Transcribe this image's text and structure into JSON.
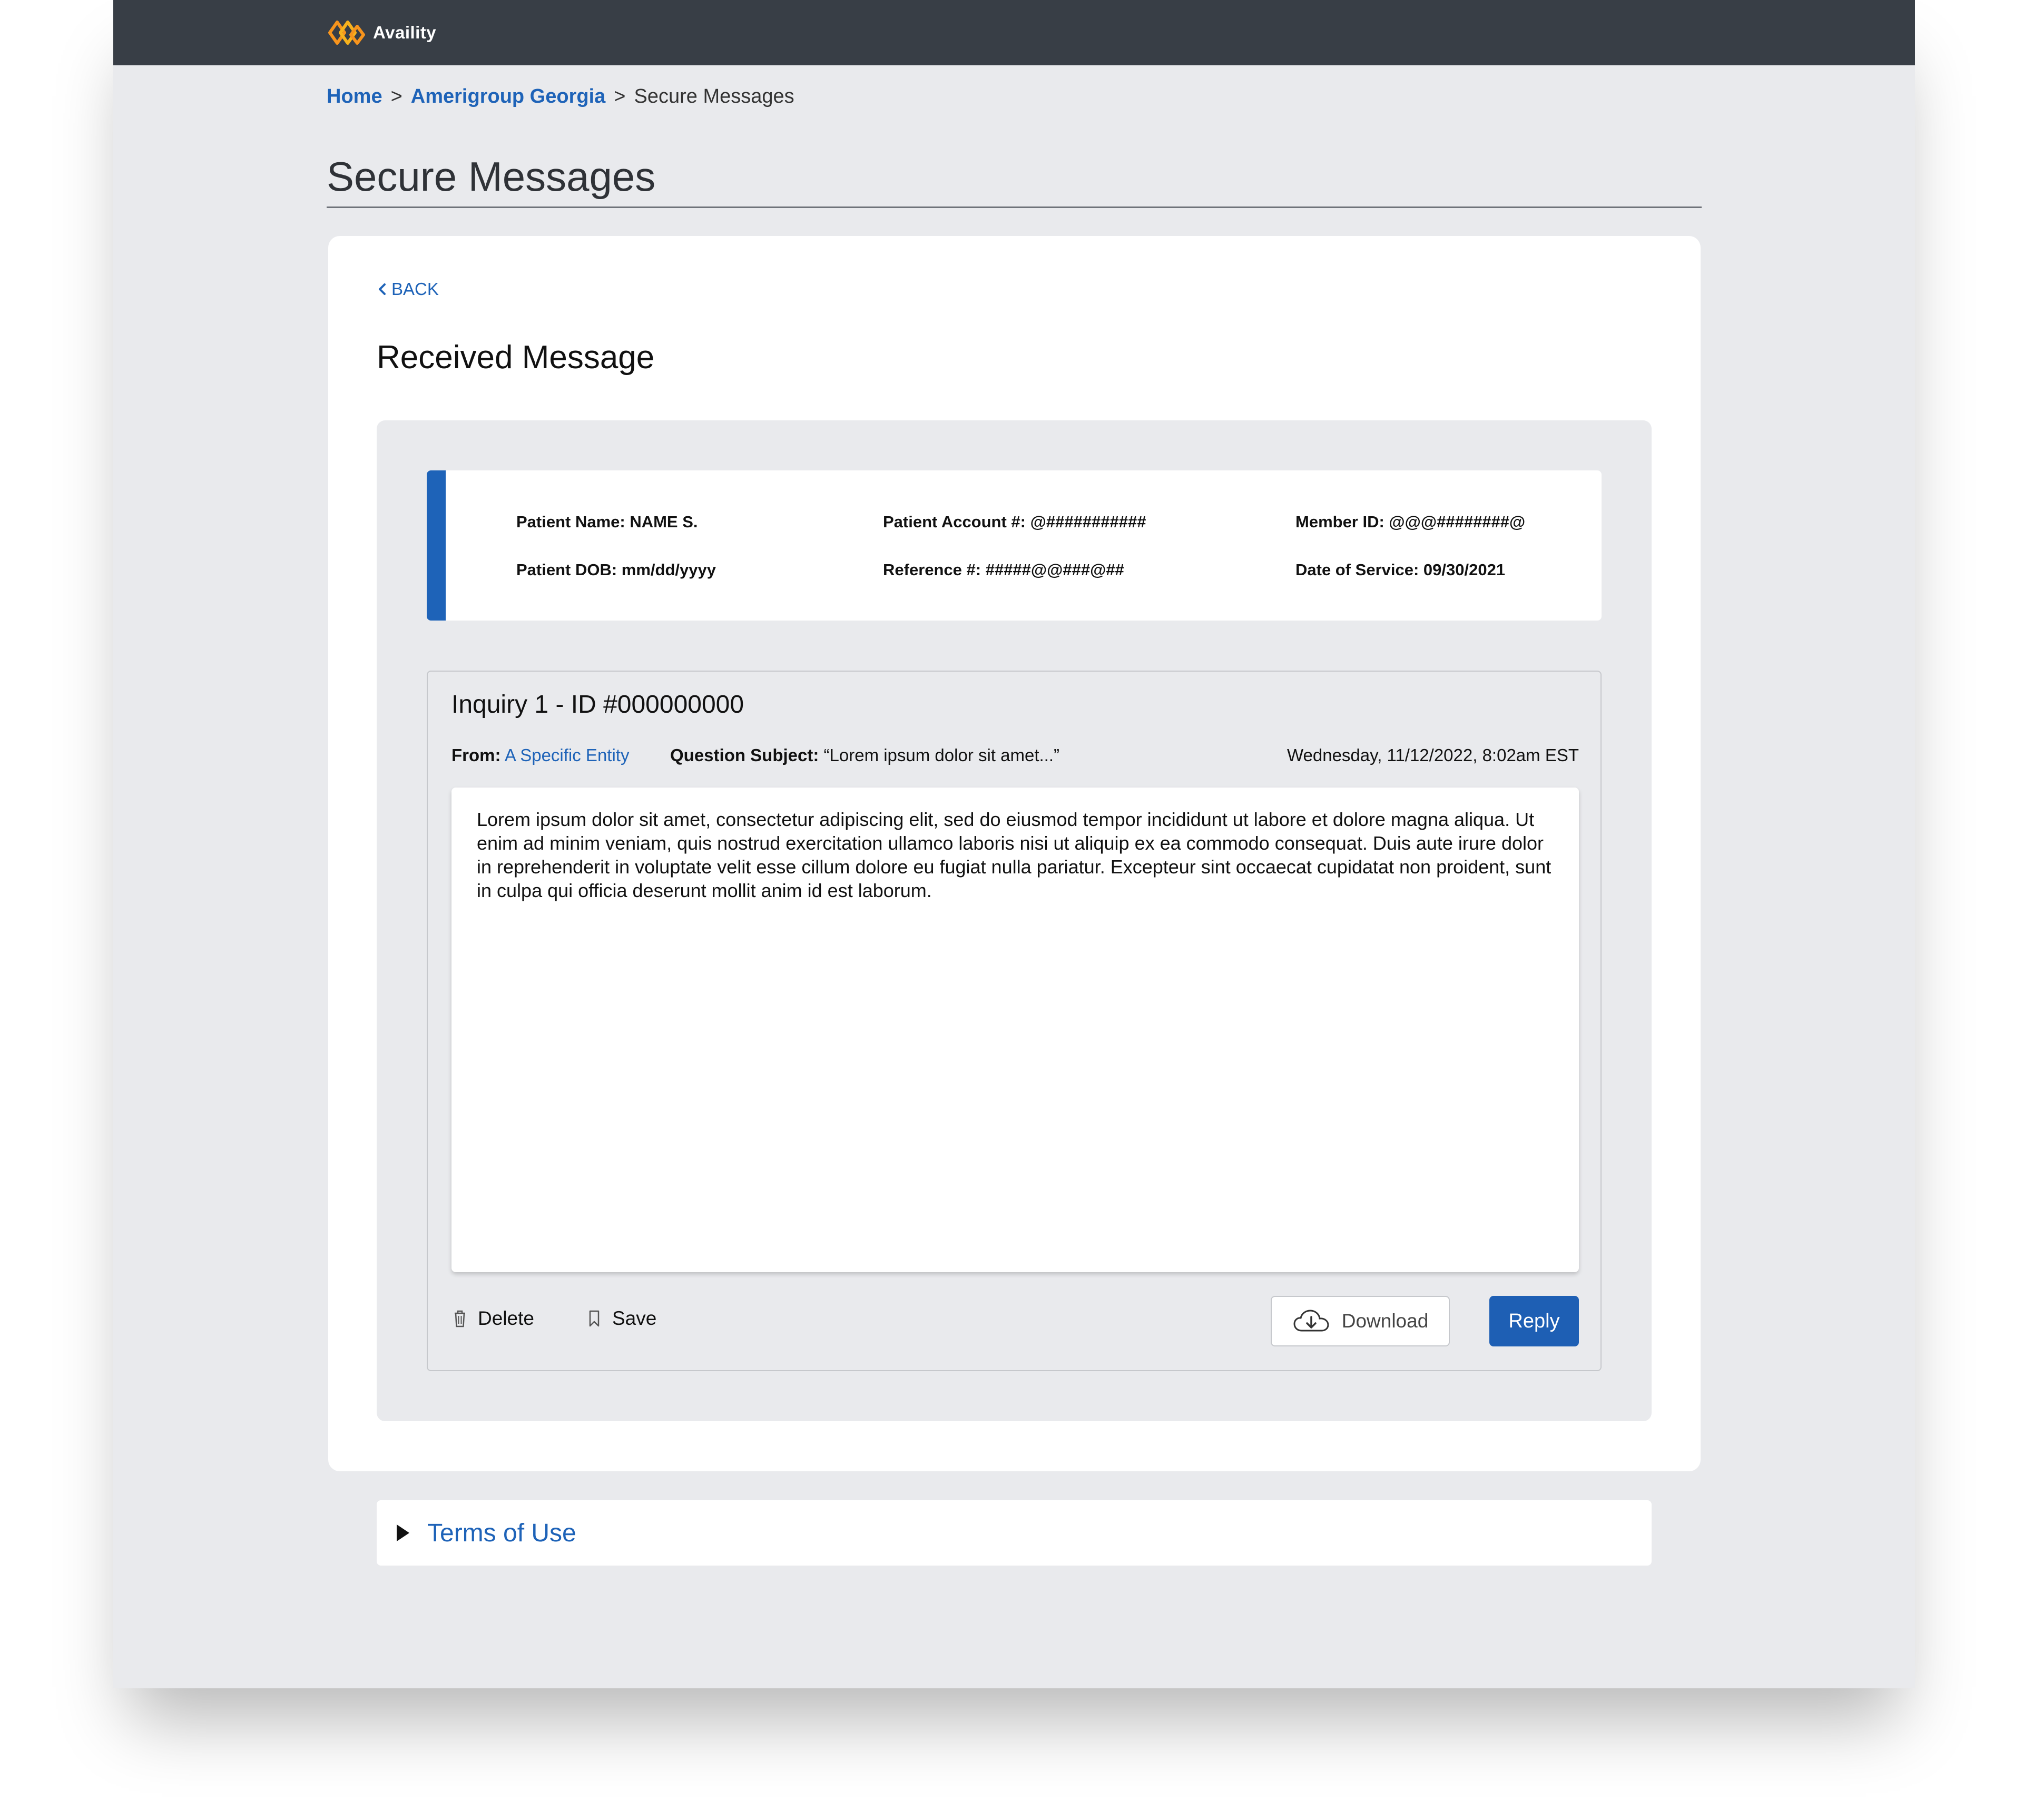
{
  "header": {
    "logo_text": "Availity"
  },
  "breadcrumb": {
    "home": "Home",
    "payer": "Amerigroup Georgia",
    "separator": ">",
    "current": "Secure Messages"
  },
  "page": {
    "title": "Secure Messages"
  },
  "card": {
    "back_label": "BACK",
    "section_title": "Received Message"
  },
  "patient_info": {
    "patient_name": "Patient Name: NAME S.",
    "patient_dob": "Patient DOB: mm/dd/yyyy",
    "patient_account": "Patient Account #: @###########",
    "reference": "Reference #: #####@@###@##",
    "member_id": "Member ID: @@@########@",
    "date_of_service": "Date of Service: 09/30/2021"
  },
  "inquiry": {
    "title": "Inquiry 1 - ID #000000000",
    "from_label": "From:",
    "from_value": "A Specific Entity",
    "subject_label": "Question Subject:",
    "subject_value": "“Lorem ipsum dolor sit amet...”",
    "timestamp": "Wednesday, 11/12/2022, 8:02am EST",
    "body": "Lorem ipsum dolor sit amet, consectetur adipiscing elit, sed do eiusmod tempor incididunt ut labore et dolore magna aliqua. Ut enim ad minim veniam, quis nostrud exercitation ullamco laboris nisi ut aliquip ex ea commodo consequat. Duis aute irure dolor in reprehenderit in voluptate velit esse cillum dolore eu fugiat nulla pariatur. Excepteur sint occaecat cupidatat non proident, sunt in culpa qui officia deserunt mollit anim id est laborum."
  },
  "actions": {
    "delete_label": "Delete",
    "save_label": "Save",
    "download_label": "Download",
    "reply_label": "Reply"
  },
  "footer": {
    "terms_label": "Terms of Use"
  },
  "colors": {
    "accent_blue": "#1e63b8",
    "top_bar": "#383e46",
    "page_background": "#e9eaed",
    "logo_orange": "#f7941d"
  },
  "icons": {
    "logo": "availity-logo-icon",
    "back": "chevron-left-icon",
    "delete": "trash-icon",
    "save": "bookmark-icon",
    "download": "cloud-download-icon",
    "terms": "caret-right-icon"
  }
}
